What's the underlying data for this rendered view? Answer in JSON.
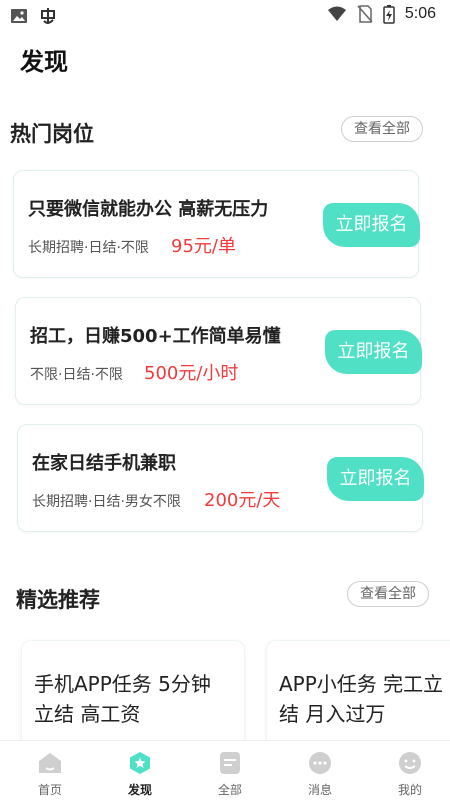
{
  "status_bar": {
    "time": "5:06"
  },
  "page": {
    "title": "发现"
  },
  "hot_jobs": {
    "title": "热门岗位",
    "see_all": "查看全部",
    "items": [
      {
        "title": "只要微信就能办公 高薪无压力",
        "meta": "长期招聘·日结·不限",
        "price": "95元/单",
        "apply": "立即报名"
      },
      {
        "title": "招工，日赚500+工作简单易懂",
        "meta": "不限·日结·不限",
        "price": "500元/小时",
        "apply": "立即报名"
      },
      {
        "title": "在家日结手机兼职",
        "meta": "长期招聘·日结·男女不限",
        "price": "200元/天",
        "apply": "立即报名"
      }
    ]
  },
  "recommend": {
    "title": "精选推荐",
    "see_all": "查看全部",
    "items": [
      {
        "title": "手机APP任务 5分钟\n立结 高工资"
      },
      {
        "title": "APP小任务 完工立\n结 月入过万"
      }
    ]
  },
  "tabbar": {
    "items": [
      {
        "label": "首页",
        "icon": "home-icon"
      },
      {
        "label": "发现",
        "icon": "discover-icon"
      },
      {
        "label": "全部",
        "icon": "list-icon"
      },
      {
        "label": "消息",
        "icon": "message-icon"
      },
      {
        "label": "我的",
        "icon": "profile-icon"
      }
    ],
    "active_index": 1
  },
  "colors": {
    "accent": "#4fe0c6",
    "price": "#f23b3b",
    "tab_inactive": "#cfcfcf"
  }
}
